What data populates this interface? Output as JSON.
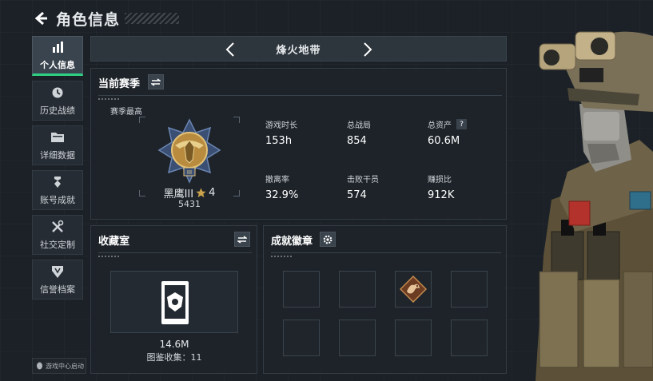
{
  "header": {
    "title": "角色信息"
  },
  "sidebar": {
    "items": [
      {
        "label": "个人信息",
        "icon": "bar-chart-icon",
        "active": true
      },
      {
        "label": "历史战绩",
        "icon": "clock-icon",
        "active": false
      },
      {
        "label": "详细数据",
        "icon": "folder-icon",
        "active": false
      },
      {
        "label": "账号成就",
        "icon": "medal-icon",
        "active": false
      },
      {
        "label": "社交定制",
        "icon": "tools-icon",
        "active": false
      },
      {
        "label": "信誉档案",
        "icon": "shield-icon",
        "active": false
      }
    ],
    "launch_badge": "游戏中心启动"
  },
  "mode_selector": {
    "name": "烽火地带"
  },
  "season": {
    "title": "当前赛季",
    "best_label": "赛季最高",
    "rank_name": "黑鹰III",
    "rank_stars": "4",
    "rank_points": "5431",
    "stats": [
      {
        "label": "游戏时长",
        "value": "153h"
      },
      {
        "label": "总战局",
        "value": "854"
      },
      {
        "label": "总资产",
        "value": "60.6M",
        "help": "?"
      },
      {
        "label": "撤离率",
        "value": "32.9%"
      },
      {
        "label": "击败干员",
        "value": "574"
      },
      {
        "label": "赚损比",
        "value": "912K"
      }
    ]
  },
  "collection": {
    "title": "收藏室",
    "value": "14.6M",
    "count_text": "图鉴收集：11"
  },
  "achievements": {
    "title": "成就徽章",
    "slots_filled": 1,
    "slots_total": 8
  },
  "colors": {
    "accent": "#2dd083",
    "panel": "#1e242a",
    "gold": "#c9a24a"
  }
}
